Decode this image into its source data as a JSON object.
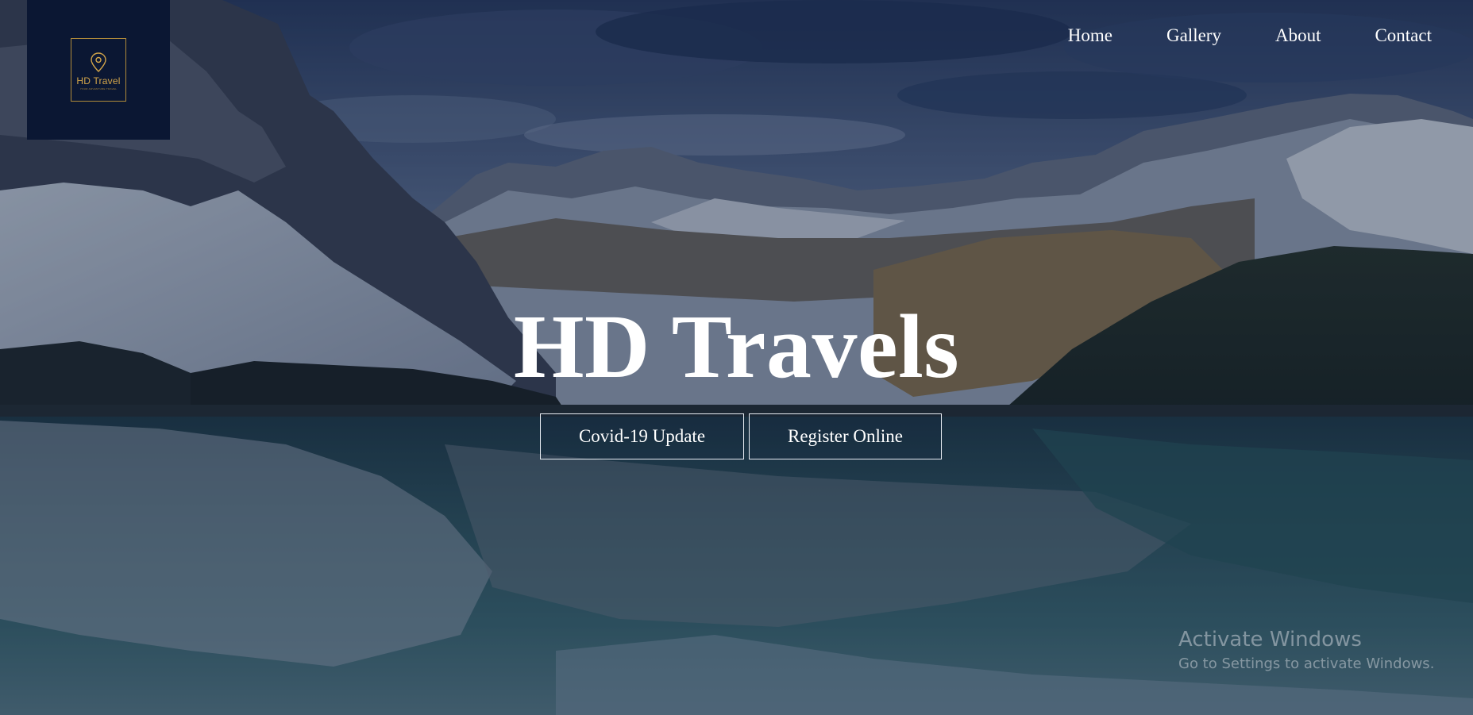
{
  "brand": {
    "logo_name": "HD Travel",
    "logo_tagline": "YOUR ADVENTURE TRAVEL",
    "logo_color": "#d4a64a",
    "logo_bg_color": "#0b1733"
  },
  "nav": {
    "items": [
      {
        "label": "Home"
      },
      {
        "label": "Gallery"
      },
      {
        "label": "About"
      },
      {
        "label": "Contact"
      }
    ]
  },
  "hero": {
    "title": "HD Travels",
    "background": "mountain-lake-reflection-photo",
    "buttons": [
      {
        "label": "Covid-19 Update"
      },
      {
        "label": "Register Online"
      }
    ]
  },
  "windows_watermark": {
    "title": "Activate Windows",
    "subtitle": "Go to Settings to activate Windows."
  },
  "colors": {
    "overlay": "#1a2438",
    "text": "#ffffff",
    "button_border": "#e8edf3"
  }
}
